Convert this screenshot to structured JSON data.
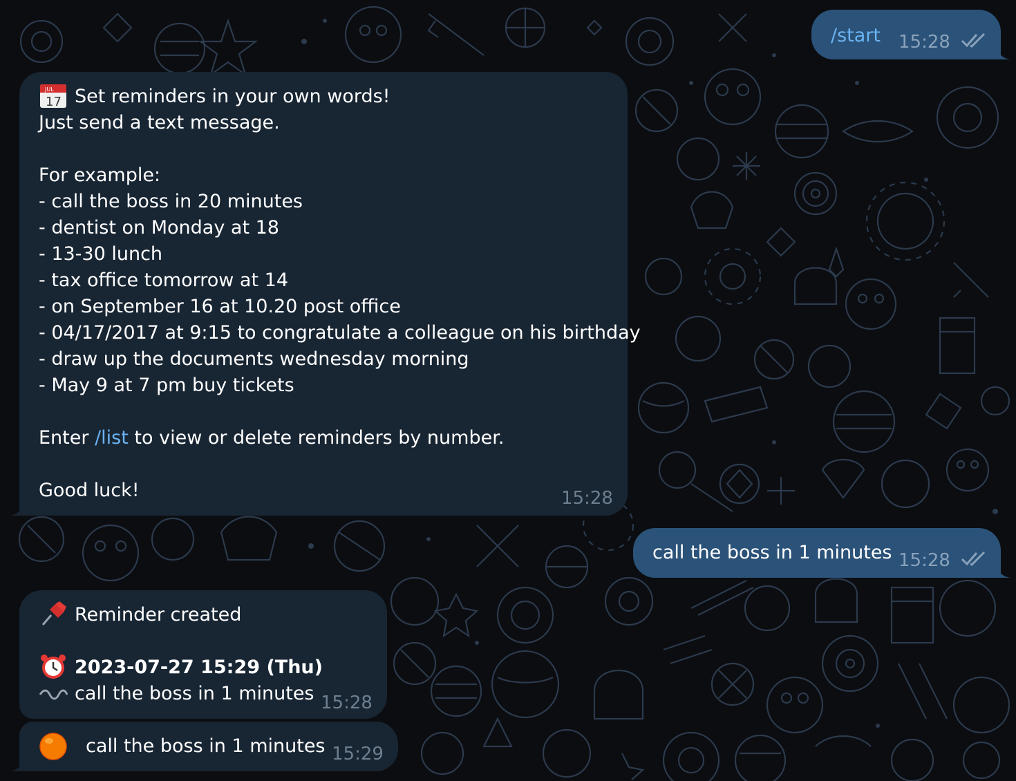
{
  "messages": {
    "start": {
      "text": "/start",
      "time": "15:28",
      "status_icon": "double-check-icon"
    },
    "help": {
      "header_icon": "calendar-icon",
      "title": "Set reminders in your own words!",
      "line2": "Just send a text message.",
      "example_heading": "For example:",
      "examples": [
        "- call the boss in 20 minutes",
        "- dentist on Monday at 18",
        "- 13-30 lunch",
        "- tax office tomorrow at 14",
        "- on September 16 at 10.20 post office",
        "- 04/17/2017 at 9:15 to congratulate a colleague on his birthday",
        "- draw up the documents wednesday morning",
        "- May 9 at 7 pm buy tickets"
      ],
      "enter_prefix": "Enter ",
      "enter_link": "/list",
      "enter_suffix": " to view or delete reminders by number.",
      "sign_off": "Good luck!",
      "time": "15:28"
    },
    "user_reminder": {
      "text": "call the boss in 1 minutes",
      "time": "15:28",
      "status_icon": "double-check-icon"
    },
    "created": {
      "title_icon": "pushpin-icon",
      "title": "Reminder created",
      "datetime_icon": "alarm-clock-icon",
      "datetime": "2023-07-27 15:29 (Thu)",
      "text_icon": "wavy-dash-icon",
      "text": "call the boss in 1 minutes",
      "time": "15:28"
    },
    "alert": {
      "icon": "orange-circle-icon",
      "text": "call the boss in 1 minutes",
      "time": "15:29"
    }
  },
  "colors": {
    "outgoing_bubble": "#2b5278",
    "incoming_bubble": "#182533",
    "link": "#6ab3f3",
    "background": "#0b0d10",
    "doodle": "#2c3a4d"
  }
}
